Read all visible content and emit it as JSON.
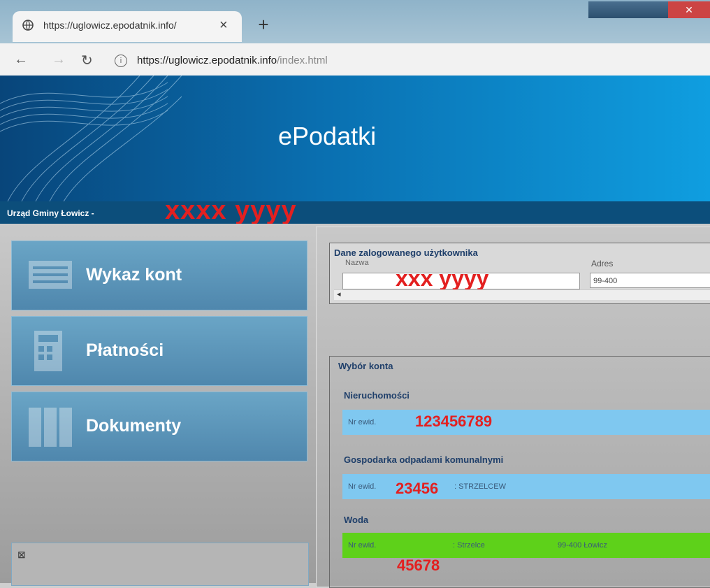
{
  "browser": {
    "tab_title": "https://uglowicz.epodatnik.info/",
    "url_host": "https://uglowicz.epodatnik.info",
    "url_path": "/index.html",
    "back_icon": "arrow-left-icon",
    "forward_icon": "arrow-right-icon",
    "reload_icon": "reload-icon",
    "info_icon": "info-icon"
  },
  "header": {
    "brand": "ePodatki",
    "org": "Urząd Gminy Łowicz -",
    "user_overlay": "xxxx yyyy"
  },
  "menu": [
    {
      "label": "Wykaz kont",
      "icon": "accounts-list-icon"
    },
    {
      "label": "Płatności",
      "icon": "calculator-icon"
    },
    {
      "label": "Dokumenty",
      "icon": "binders-icon"
    }
  ],
  "user_panel": {
    "legend": "Dane zalogowanego użytkownika",
    "name_label": "Nazwa",
    "address_label": "Adres",
    "name_overlay": "xxx yyyy",
    "address_value": "99-400"
  },
  "accounts": {
    "legend": "Wybór konta",
    "sections": [
      {
        "title": "Nieruchomości",
        "nr_label": "Nr ewid.",
        "overlay": "123456789",
        "extra": "",
        "color": "#7fc8f0"
      },
      {
        "title": "Gospodarka odpadami komunalnymi",
        "nr_label": "Nr ewid.",
        "overlay": "23456",
        "extra": ": STRZELCEW",
        "color": "#7fc8f0"
      },
      {
        "title": "Woda",
        "nr_label": "Nr ewid.",
        "overlay": "45678",
        "extra": ": Strzelce",
        "extra2": "99-400 Łowicz",
        "color": "#5ed11a"
      }
    ]
  }
}
